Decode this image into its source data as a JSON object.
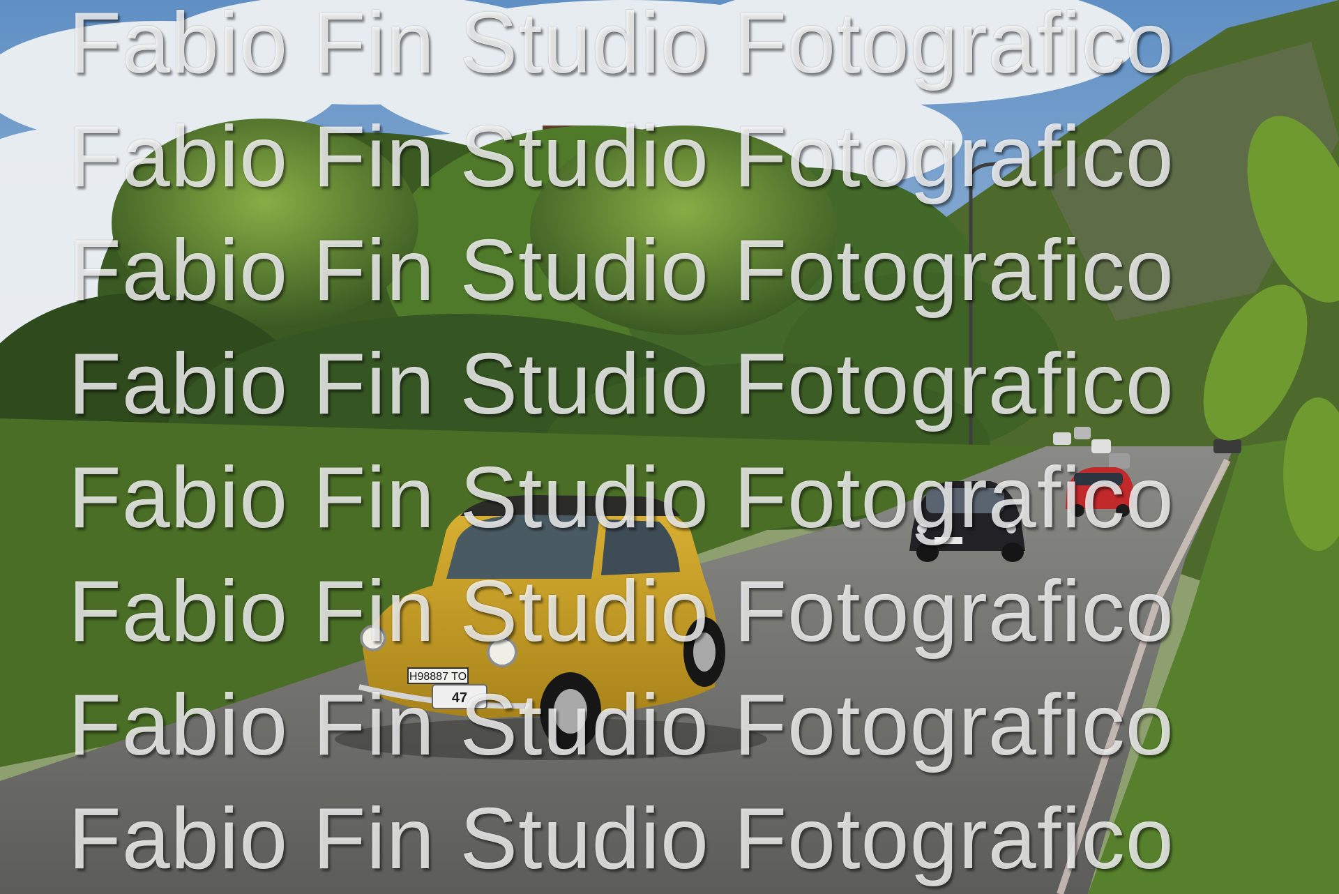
{
  "photo": {
    "subject": "vintage-fiat-500-convoy-on-country-road",
    "lead_car": {
      "color": "#c9a122",
      "plate": "H98887 TO",
      "rally_number": "47"
    },
    "second_car": {
      "color": "#222226"
    },
    "third_car": {
      "color": "#c2292b"
    },
    "palette": {
      "sky": "#7fa6cf",
      "cloud": "#eef1f3",
      "foliage_dark": "#2f4a1c",
      "foliage_light": "#7ea43a",
      "road": "#6e6e6c",
      "tower": "#7a4f3a"
    }
  },
  "watermark": {
    "text": "Fabio Fin Studio Fotografico",
    "repeat_count": 8
  }
}
